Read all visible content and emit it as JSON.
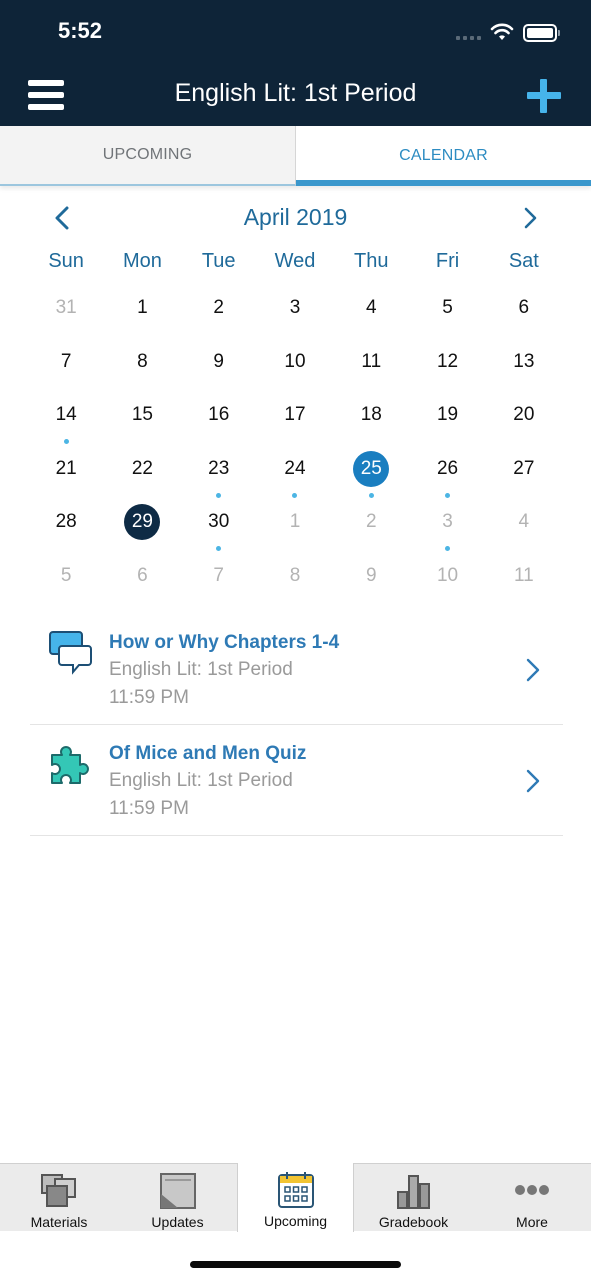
{
  "status_bar": {
    "time": "5:52"
  },
  "nav": {
    "title": "English Lit: 1st Period",
    "menu_icon": "hamburger-icon",
    "add_icon": "plus-icon"
  },
  "tabs": [
    {
      "label": "UPCOMING",
      "active": false
    },
    {
      "label": "CALENDAR",
      "active": true
    }
  ],
  "calendar": {
    "month_label": "April 2019",
    "prev_icon": "chevron-left-icon",
    "next_icon": "chevron-right-icon",
    "weekdays": [
      "Sun",
      "Mon",
      "Tue",
      "Wed",
      "Thu",
      "Fri",
      "Sat"
    ],
    "days": [
      {
        "d": "31",
        "other": true
      },
      {
        "d": "1"
      },
      {
        "d": "2"
      },
      {
        "d": "3"
      },
      {
        "d": "4"
      },
      {
        "d": "5"
      },
      {
        "d": "6"
      },
      {
        "d": "7"
      },
      {
        "d": "8"
      },
      {
        "d": "9"
      },
      {
        "d": "10"
      },
      {
        "d": "11"
      },
      {
        "d": "12"
      },
      {
        "d": "13"
      },
      {
        "d": "14",
        "dot": true
      },
      {
        "d": "15"
      },
      {
        "d": "16"
      },
      {
        "d": "17"
      },
      {
        "d": "18"
      },
      {
        "d": "19"
      },
      {
        "d": "20"
      },
      {
        "d": "21"
      },
      {
        "d": "22"
      },
      {
        "d": "23",
        "dot": true
      },
      {
        "d": "24",
        "dot": true
      },
      {
        "d": "25",
        "dot": true,
        "selected": true
      },
      {
        "d": "26",
        "dot": true
      },
      {
        "d": "27"
      },
      {
        "d": "28"
      },
      {
        "d": "29",
        "today": true
      },
      {
        "d": "30",
        "dot": true
      },
      {
        "d": "1",
        "other": true
      },
      {
        "d": "2",
        "other": true
      },
      {
        "d": "3",
        "other": true,
        "dot": true
      },
      {
        "d": "4",
        "other": true
      },
      {
        "d": "5",
        "other": true
      },
      {
        "d": "6",
        "other": true
      },
      {
        "d": "7",
        "other": true
      },
      {
        "d": "8",
        "other": true
      },
      {
        "d": "9",
        "other": true
      },
      {
        "d": "10",
        "other": true
      },
      {
        "d": "11",
        "other": true
      }
    ]
  },
  "events": [
    {
      "title": "How or Why Chapters 1-4",
      "course": "English Lit: 1st Period",
      "time": "11:59 PM",
      "icon": "discussion-icon"
    },
    {
      "title": "Of Mice and Men Quiz",
      "course": "English Lit: 1st Period",
      "time": "11:59 PM",
      "icon": "assessment-puzzle-icon"
    }
  ],
  "tabbar": [
    {
      "label": "Materials",
      "icon": "materials-icon",
      "active": false
    },
    {
      "label": "Updates",
      "icon": "updates-icon",
      "active": false
    },
    {
      "label": "Upcoming",
      "icon": "calendar-icon",
      "active": true
    },
    {
      "label": "Gradebook",
      "icon": "gradebook-icon",
      "active": false
    },
    {
      "label": "More",
      "icon": "more-icon",
      "active": false
    }
  ],
  "colors": {
    "nav_bg": "#0e2438",
    "accent": "#2d8cc2",
    "selected_day": "#1a7ec0",
    "today": "#0e2b45",
    "event_dot": "#4cb5e4",
    "add_button": "#46b4ea"
  }
}
